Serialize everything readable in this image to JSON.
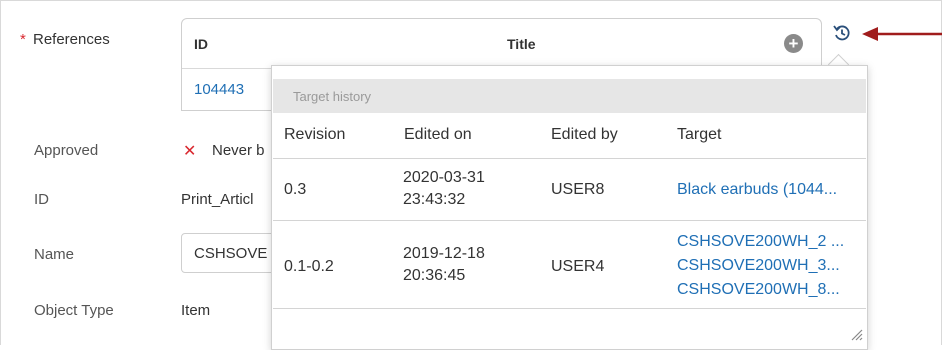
{
  "form": {
    "required_marker": "*",
    "references_label": "References",
    "approved_label": "Approved",
    "approved_value": "Never b",
    "id_label": "ID",
    "id_value": "Print_Articl",
    "name_label": "Name",
    "name_value": "CSHSOVE",
    "object_type_label": "Object Type",
    "object_type_value": "Item"
  },
  "references_table": {
    "columns": [
      "ID",
      "Title"
    ],
    "rows": [
      {
        "id": "104443"
      }
    ]
  },
  "history_popup": {
    "title": "Target history",
    "columns": [
      "Revision",
      "Edited on",
      "Edited by",
      "Target"
    ],
    "rows": [
      {
        "revision": "0.3",
        "edited_on_date": "2020-03-31",
        "edited_on_time": "23:43:32",
        "edited_by": "USER8",
        "targets": [
          "Black earbuds (1044..."
        ]
      },
      {
        "revision": "0.1-0.2",
        "edited_on_date": "2019-12-18",
        "edited_on_time": "20:36:45",
        "edited_by": "USER4",
        "targets": [
          "CSHSOVE200WH_2 ...",
          "CSHSOVE200WH_3...",
          "CSHSOVE200WH_8..."
        ]
      }
    ]
  },
  "icons": {
    "history": "history-icon",
    "add": "plus-circle-icon",
    "close_x": "x-icon",
    "arrow": "arrow-left-icon",
    "resize": "resize-grip-icon"
  },
  "colors": {
    "link": "#1f6fb5",
    "required": "#d9282f",
    "annotation_arrow": "#a01c1c",
    "popup_header": "#e6e6e6"
  }
}
